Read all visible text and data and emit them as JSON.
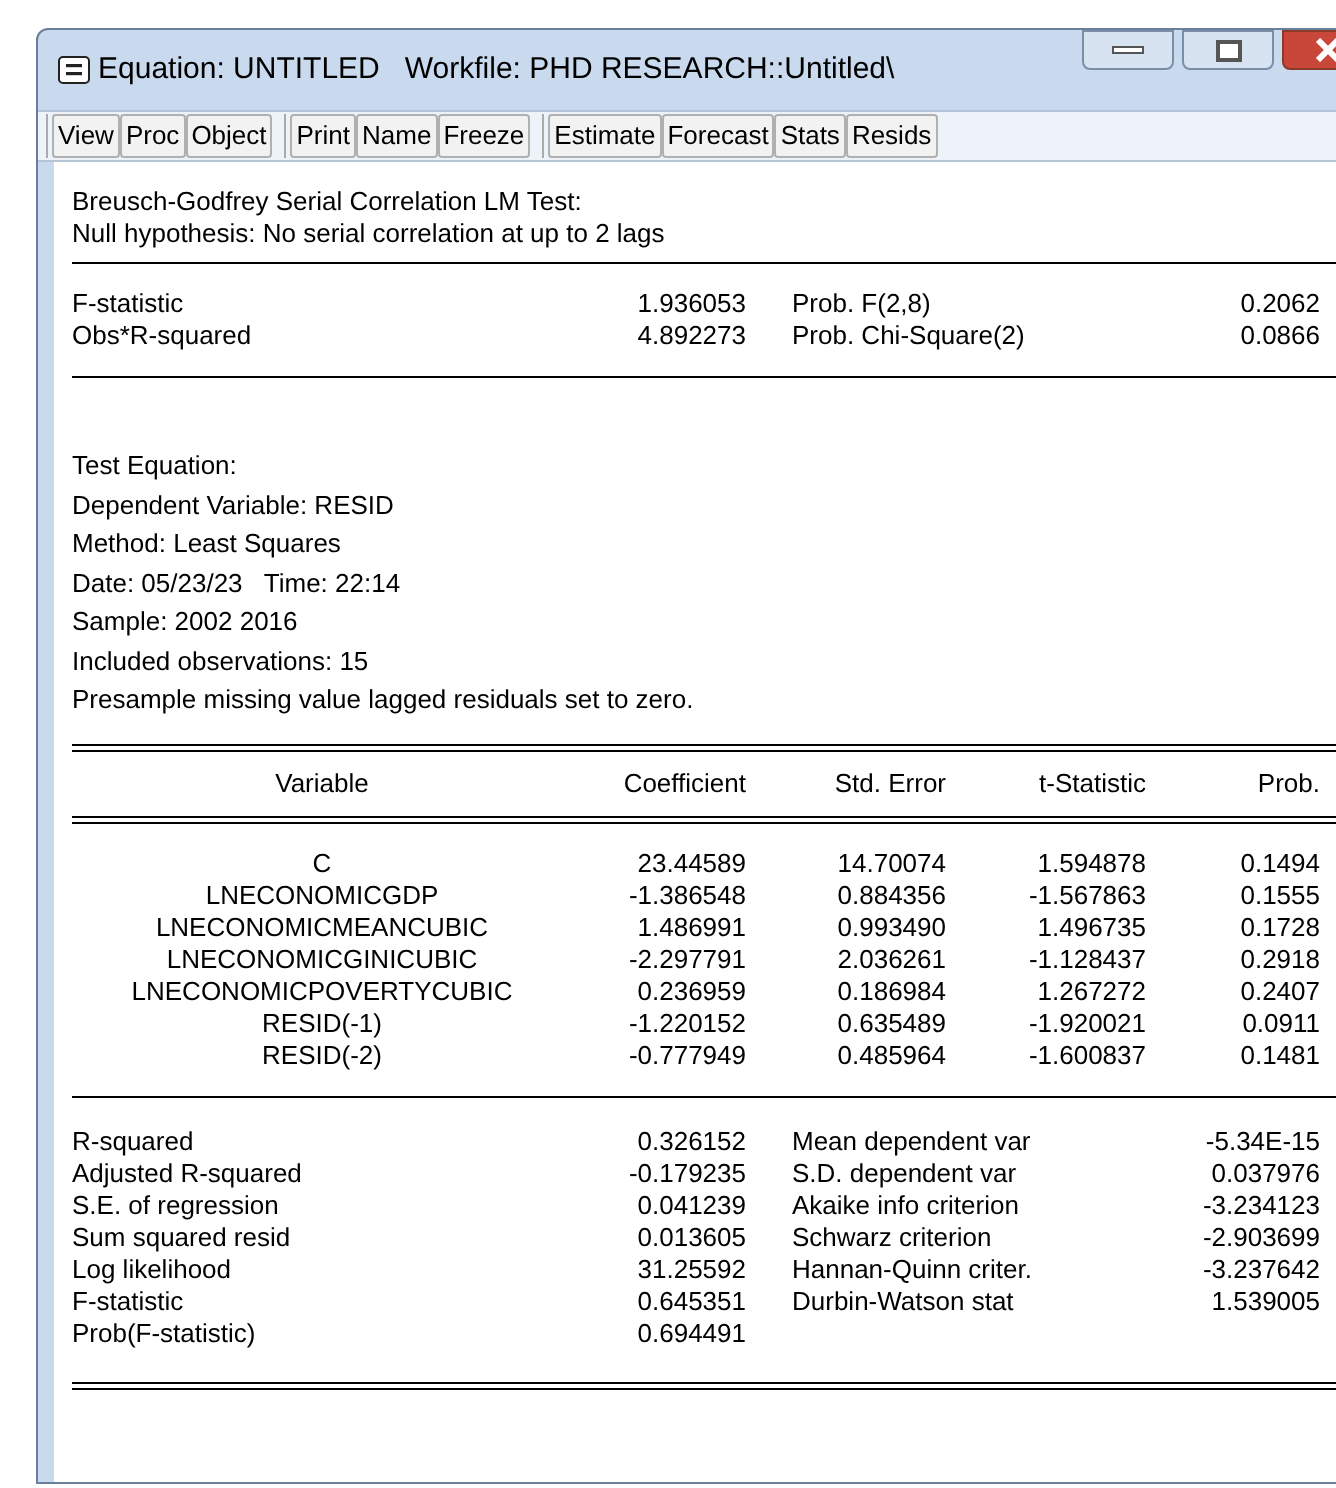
{
  "window": {
    "title": "Equation: UNTITLED   Workfile: PHD RESEARCH::Untitled\\"
  },
  "toolbar": {
    "groups": [
      [
        "View",
        "Proc",
        "Object"
      ],
      [
        "Print",
        "Name",
        "Freeze"
      ],
      [
        "Estimate",
        "Forecast",
        "Stats",
        "Resids"
      ]
    ]
  },
  "header": [
    "Breusch-Godfrey Serial Correlation LM Test:",
    "Null hypothesis: No serial correlation at up to 2 lags"
  ],
  "test_stats": [
    {
      "label": "F-statistic",
      "value": "1.936053",
      "prob_label": "Prob. F(2,8)",
      "prob": "0.2062"
    },
    {
      "label": "Obs*R-squared",
      "value": "4.892273",
      "prob_label": "Prob. Chi-Square(2)",
      "prob": "0.0866"
    }
  ],
  "test_equation": [
    "Test Equation:",
    "Dependent Variable: RESID",
    "Method: Least Squares",
    "Date: 05/23/23   Time: 22:14",
    "Sample: 2002 2016",
    "Included observations: 15",
    "Presample missing value lagged residuals set to zero."
  ],
  "table": {
    "columns": [
      "Variable",
      "Coefficient",
      "Std. Error",
      "t-Statistic",
      "Prob."
    ],
    "rows": [
      [
        "C",
        "23.44589",
        "14.70074",
        "1.594878",
        "0.1494"
      ],
      [
        "LNECONOMICGDP",
        "-1.386548",
        "0.884356",
        "-1.567863",
        "0.1555"
      ],
      [
        "LNECONOMICMEANCUBIC",
        "1.486991",
        "0.993490",
        "1.496735",
        "0.1728"
      ],
      [
        "LNECONOMICGINICUBIC",
        "-2.297791",
        "2.036261",
        "-1.128437",
        "0.2918"
      ],
      [
        "LNECONOMICPOVERTYCUBIC",
        "0.236959",
        "0.186984",
        "1.267272",
        "0.2407"
      ],
      [
        "RESID(-1)",
        "-1.220152",
        "0.635489",
        "-1.920021",
        "0.0911"
      ],
      [
        "RESID(-2)",
        "-0.777949",
        "0.485964",
        "-1.600837",
        "0.1481"
      ]
    ]
  },
  "summary": [
    [
      "R-squared",
      "0.326152",
      "Mean dependent var",
      "-5.34E-15"
    ],
    [
      "Adjusted R-squared",
      "-0.179235",
      "S.D. dependent var",
      "0.037976"
    ],
    [
      "S.E. of regression",
      "0.041239",
      "Akaike info criterion",
      "-3.234123"
    ],
    [
      "Sum squared resid",
      "0.013605",
      "Schwarz criterion",
      "-2.903699"
    ],
    [
      "Log likelihood",
      "31.25592",
      "Hannan-Quinn criter.",
      "-3.237642"
    ],
    [
      "F-statistic",
      "0.645351",
      "Durbin-Watson stat",
      "1.539005"
    ],
    [
      "Prob(F-statistic)",
      "0.694491"
    ]
  ]
}
